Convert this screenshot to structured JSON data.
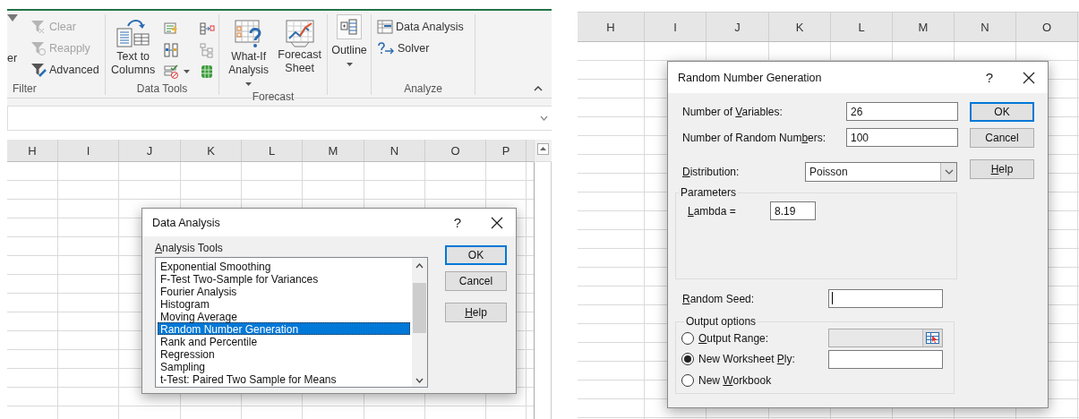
{
  "ribbon": {
    "sort_filter": {
      "cut_button_label": "er",
      "group_label": "Filter",
      "commands": [
        {
          "label": "Clear",
          "disabled": true
        },
        {
          "label": "Reapply",
          "disabled": true
        },
        {
          "label": "Advanced",
          "disabled": false
        }
      ]
    },
    "data_tools": {
      "text_to_columns": "Text to Columns",
      "group_label": "Data Tools"
    },
    "forecast": {
      "what_if": "What-If Analysis",
      "forecast_sheet": "Forecast Sheet",
      "group_label": "Forecast"
    },
    "outline": {
      "label": "Outline"
    },
    "analyze": {
      "commands": [
        "Data Analysis",
        "Solver"
      ],
      "group_label": "Analyze"
    }
  },
  "left_sheet": {
    "columns": [
      "H",
      "I",
      "J",
      "K",
      "L",
      "M",
      "N",
      "O",
      "P"
    ]
  },
  "data_analysis_dialog": {
    "title": "Data Analysis",
    "help": "?",
    "list_label": [
      {
        "text": "A",
        "underlined": true
      },
      {
        "text": "nalysis Tools",
        "underlined": false
      }
    ],
    "items": [
      {
        "label": "Exponential Smoothing",
        "selected": false
      },
      {
        "label": "F-Test Two-Sample for Variances",
        "selected": false
      },
      {
        "label": "Fourier Analysis",
        "selected": false
      },
      {
        "label": "Histogram",
        "selected": false
      },
      {
        "label": "Moving Average",
        "selected": false
      },
      {
        "label": "Random Number Generation",
        "selected": true
      },
      {
        "label": "Rank and Percentile",
        "selected": false
      },
      {
        "label": "Regression",
        "selected": false
      },
      {
        "label": "Sampling",
        "selected": false
      },
      {
        "label": "t-Test: Paired Two Sample for Means",
        "selected": false
      }
    ],
    "buttons": [
      {
        "label": [
          {
            "text": "OK",
            "underlined": false
          }
        ],
        "default": true
      },
      {
        "label": [
          {
            "text": "Cancel",
            "underlined": false
          }
        ],
        "default": false
      },
      {
        "label": [
          {
            "text": "H",
            "underlined": true
          },
          {
            "text": "elp",
            "underlined": false
          }
        ],
        "default": false
      }
    ]
  },
  "right_sheet": {
    "columns": [
      "H",
      "I",
      "J",
      "K",
      "L",
      "M",
      "N",
      "O"
    ]
  },
  "rng_dialog": {
    "title": "Random Number Generation",
    "help": "?",
    "fields": [
      {
        "label": [
          {
            "text": "Number of ",
            "underlined": false
          },
          {
            "text": "V",
            "underlined": true
          },
          {
            "text": "ariables:",
            "underlined": false
          }
        ],
        "value": "26"
      },
      {
        "label": [
          {
            "text": "Number of Random Num",
            "underlined": false
          },
          {
            "text": "b",
            "underlined": true
          },
          {
            "text": "ers:",
            "underlined": false
          }
        ],
        "value": "100"
      }
    ],
    "distribution": {
      "label": [
        {
          "text": "D",
          "underlined": true
        },
        {
          "text": "istribution:",
          "underlined": false
        }
      ],
      "value": "Poisson"
    },
    "parameters": {
      "legend": "Parameters",
      "label": [
        {
          "text": "L",
          "underlined": true
        },
        {
          "text": "ambda =",
          "underlined": false
        }
      ],
      "value": "8.19"
    },
    "random_seed": {
      "label": [
        {
          "text": "R",
          "underlined": true
        },
        {
          "text": "andom Seed:",
          "underlined": false
        }
      ],
      "focused": true
    },
    "output": {
      "legend": "Output options",
      "options": [
        {
          "kind": "range",
          "label": [
            {
              "text": "O",
              "underlined": true
            },
            {
              "text": "utput Range:",
              "underlined": false
            }
          ],
          "selected": false
        },
        {
          "kind": "field",
          "label": [
            {
              "text": "New Worksheet ",
              "underlined": false
            },
            {
              "text": "P",
              "underlined": true
            },
            {
              "text": "ly:",
              "underlined": false
            }
          ],
          "selected": true
        },
        {
          "kind": "plain",
          "label": [
            {
              "text": "New ",
              "underlined": false
            },
            {
              "text": "W",
              "underlined": true
            },
            {
              "text": "orkbook",
              "underlined": false
            }
          ],
          "selected": false
        }
      ]
    },
    "buttons": [
      {
        "label": [
          {
            "text": "OK",
            "underlined": false
          }
        ],
        "default": true
      },
      {
        "label": [
          {
            "text": "Cancel",
            "underlined": false
          }
        ],
        "default": false
      },
      {
        "label": [
          {
            "text": "H",
            "underlined": true
          },
          {
            "text": "elp",
            "underlined": false
          }
        ],
        "default": false
      }
    ]
  }
}
